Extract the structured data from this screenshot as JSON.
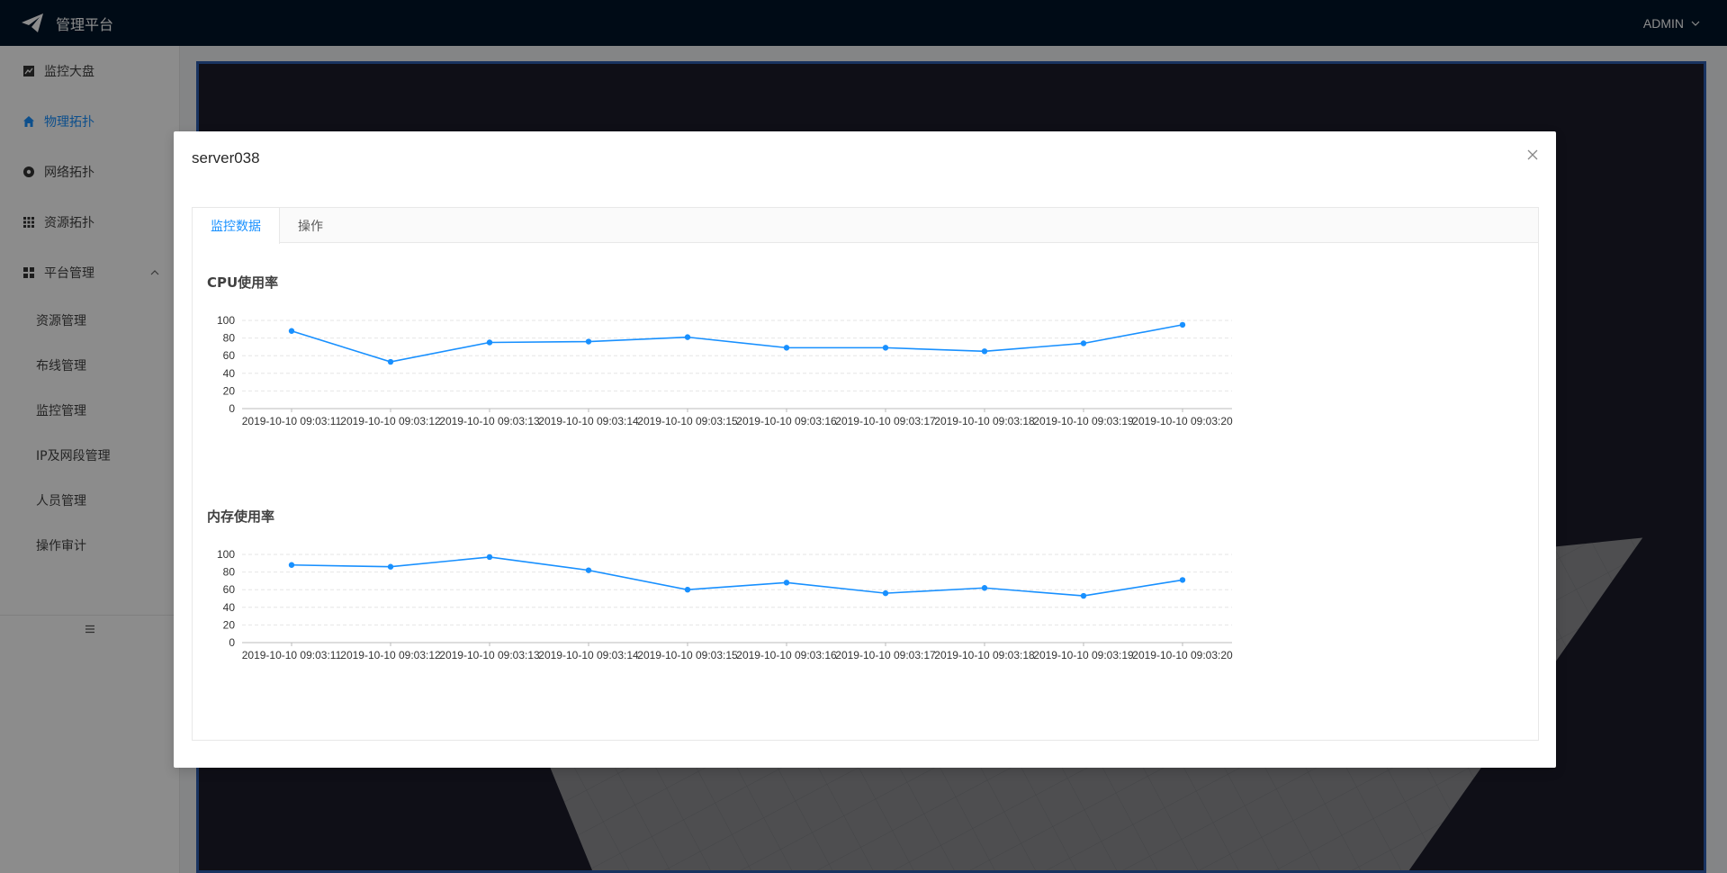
{
  "app": {
    "title": "管理平台",
    "user": "ADMIN"
  },
  "sidebar": {
    "items": [
      {
        "label": "监控大盘",
        "icon": "line-chart-icon"
      },
      {
        "label": "物理拓扑",
        "icon": "home-icon",
        "active": true
      },
      {
        "label": "网络拓扑",
        "icon": "compass-icon"
      },
      {
        "label": "资源拓扑",
        "icon": "appstore-icon"
      },
      {
        "label": "平台管理",
        "icon": "grid-icon",
        "expanded": true
      }
    ],
    "sub_items": [
      {
        "label": "资源管理"
      },
      {
        "label": "布线管理"
      },
      {
        "label": "监控管理"
      },
      {
        "label": "IP及网段管理"
      },
      {
        "label": "人员管理"
      },
      {
        "label": "操作审计"
      }
    ]
  },
  "modal": {
    "title": "server038",
    "tabs": [
      {
        "label": "监控数据",
        "active": true
      },
      {
        "label": "操作"
      }
    ]
  },
  "colors": {
    "accent": "#1890ff",
    "header_bg": "#001529",
    "scene_bg": "#1c1d2b"
  },
  "chart_data": [
    {
      "type": "line",
      "title": "CPU使用率",
      "x": [
        "2019-10-10 09:03:11",
        "2019-10-10 09:03:12",
        "2019-10-10 09:03:13",
        "2019-10-10 09:03:14",
        "2019-10-10 09:03:15",
        "2019-10-10 09:03:16",
        "2019-10-10 09:03:17",
        "2019-10-10 09:03:18",
        "2019-10-10 09:03:19",
        "2019-10-10 09:03:20"
      ],
      "values": [
        88,
        53,
        75,
        76,
        81,
        69,
        69,
        65,
        74,
        95
      ],
      "ylim": [
        0,
        100
      ],
      "yticks": [
        0,
        20,
        40,
        60,
        80,
        100
      ],
      "grid": true,
      "color": "#1890ff"
    },
    {
      "type": "line",
      "title": "内存使用率",
      "x": [
        "2019-10-10 09:03:11",
        "2019-10-10 09:03:12",
        "2019-10-10 09:03:13",
        "2019-10-10 09:03:14",
        "2019-10-10 09:03:15",
        "2019-10-10 09:03:16",
        "2019-10-10 09:03:17",
        "2019-10-10 09:03:18",
        "2019-10-10 09:03:19",
        "2019-10-10 09:03:20"
      ],
      "values": [
        88,
        86,
        97,
        82,
        60,
        68,
        56,
        62,
        53,
        71
      ],
      "ylim": [
        0,
        100
      ],
      "yticks": [
        0,
        20,
        40,
        60,
        80,
        100
      ],
      "grid": true,
      "color": "#1890ff"
    }
  ]
}
